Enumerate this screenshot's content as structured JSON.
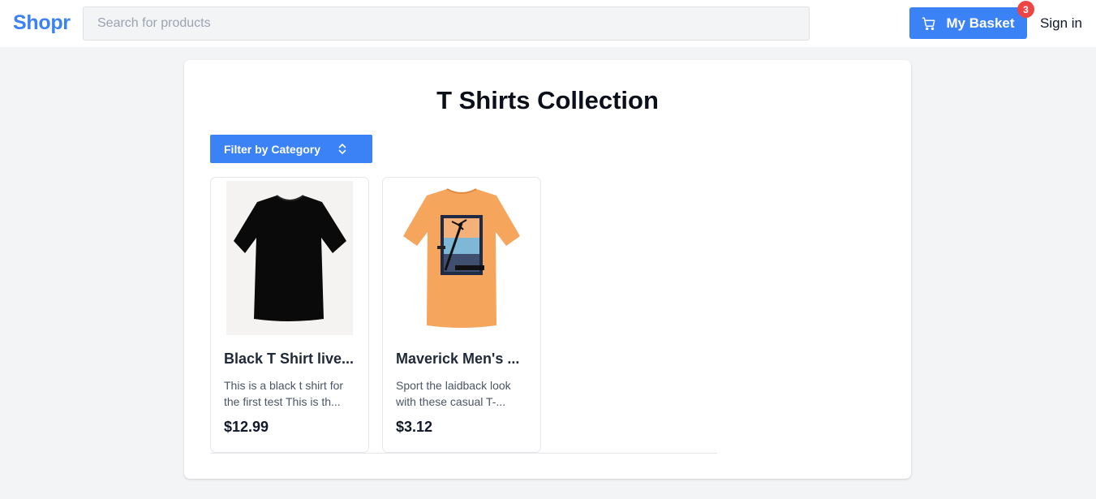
{
  "header": {
    "logo": "Shopr",
    "search_placeholder": "Search for products",
    "search_value": "",
    "basket_label": "My Basket",
    "basket_count": "3",
    "signin_label": "Sign in"
  },
  "main": {
    "title": "T Shirts Collection",
    "filter_label": "Filter by Category",
    "products": [
      {
        "name": "Black T Shirt live...",
        "description": "This is a black t shirt for the first test This is th...",
        "price": "$12.99",
        "image": "black-tshirt-image"
      },
      {
        "name": "Maverick Men's ...",
        "description": "Sport the laidback look with these casual T-...",
        "price": "$3.12",
        "image": "orange-graphic-tshirt-image"
      }
    ]
  },
  "colors": {
    "accent": "#3b82f6",
    "badge": "#ef4444",
    "background": "#f3f4f6"
  },
  "icons": {
    "basket": "cart-icon",
    "filter": "chevron-up-down-icon"
  }
}
